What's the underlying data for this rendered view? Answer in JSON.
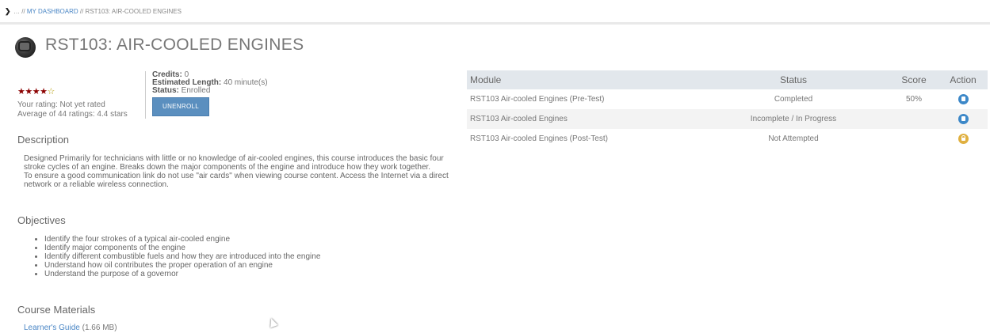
{
  "breadcrumb": {
    "prefix": "… // ",
    "dashboard": "MY DASHBOARD",
    "separator": " // ",
    "current": "RST103: AIR-COOLED ENGINES"
  },
  "course": {
    "title": "RST103: AIR-COOLED ENGINES",
    "stars_filled": "★★★★",
    "stars_empty": "☆",
    "rating_value": 4.4,
    "your_rating": "Your rating: Not yet rated",
    "average_rating": "Average of 44 ratings: 4.4 stars",
    "credits_label": "Credits:",
    "credits_value": " 0",
    "length_label": "Estimated Length:",
    "length_value": " 40 minute(s)",
    "status_label": "Status:",
    "status_value": " Enrolled",
    "unenroll_label": "UNENROLL"
  },
  "sections": {
    "description_heading": "Description",
    "description_lines": [
      "Designed Primarily for technicians with little or no knowledge of air-cooled engines, this course introduces the basic four stroke cycles of an engine.  Breaks down the major components of the engine and introduce how they work together.",
      "To ensure a good communication link do not use \"air cards\" when viewing course content. Access the Internet via a direct network or a reliable wireless connection."
    ],
    "objectives_heading": "Objectives",
    "objectives": [
      "Identify the four strokes of a typical air-cooled engine",
      "Identify major components of the engine",
      "Identify different combustible fuels and how they are introduced into the engine",
      "Understand how oil contributes the proper operation of an engine",
      "Understand the purpose of a governor"
    ],
    "materials_heading": "Course Materials",
    "material_link": "Learner's Guide",
    "material_size": " (1.66 MB)"
  },
  "modules": {
    "headers": [
      "Module",
      "Status",
      "Score",
      "Action"
    ],
    "rows": [
      {
        "module": "RST103 Air-cooled Engines (Pre-Test)",
        "status": "Completed",
        "score": "50%",
        "action_icon": "launch-icon"
      },
      {
        "module": "RST103 Air-cooled Engines",
        "status": "Incomplete / In Progress",
        "score": "",
        "action_icon": "launch-icon"
      },
      {
        "module": "RST103 Air-cooled Engines (Post-Test)",
        "status": "Not Attempted",
        "score": "",
        "action_icon": "lock-icon"
      }
    ]
  },
  "colors": {
    "accent": "#4a86c5",
    "button": "#5b8fbf",
    "stars": "#8b0000",
    "table_header": "#e2e7ec"
  }
}
